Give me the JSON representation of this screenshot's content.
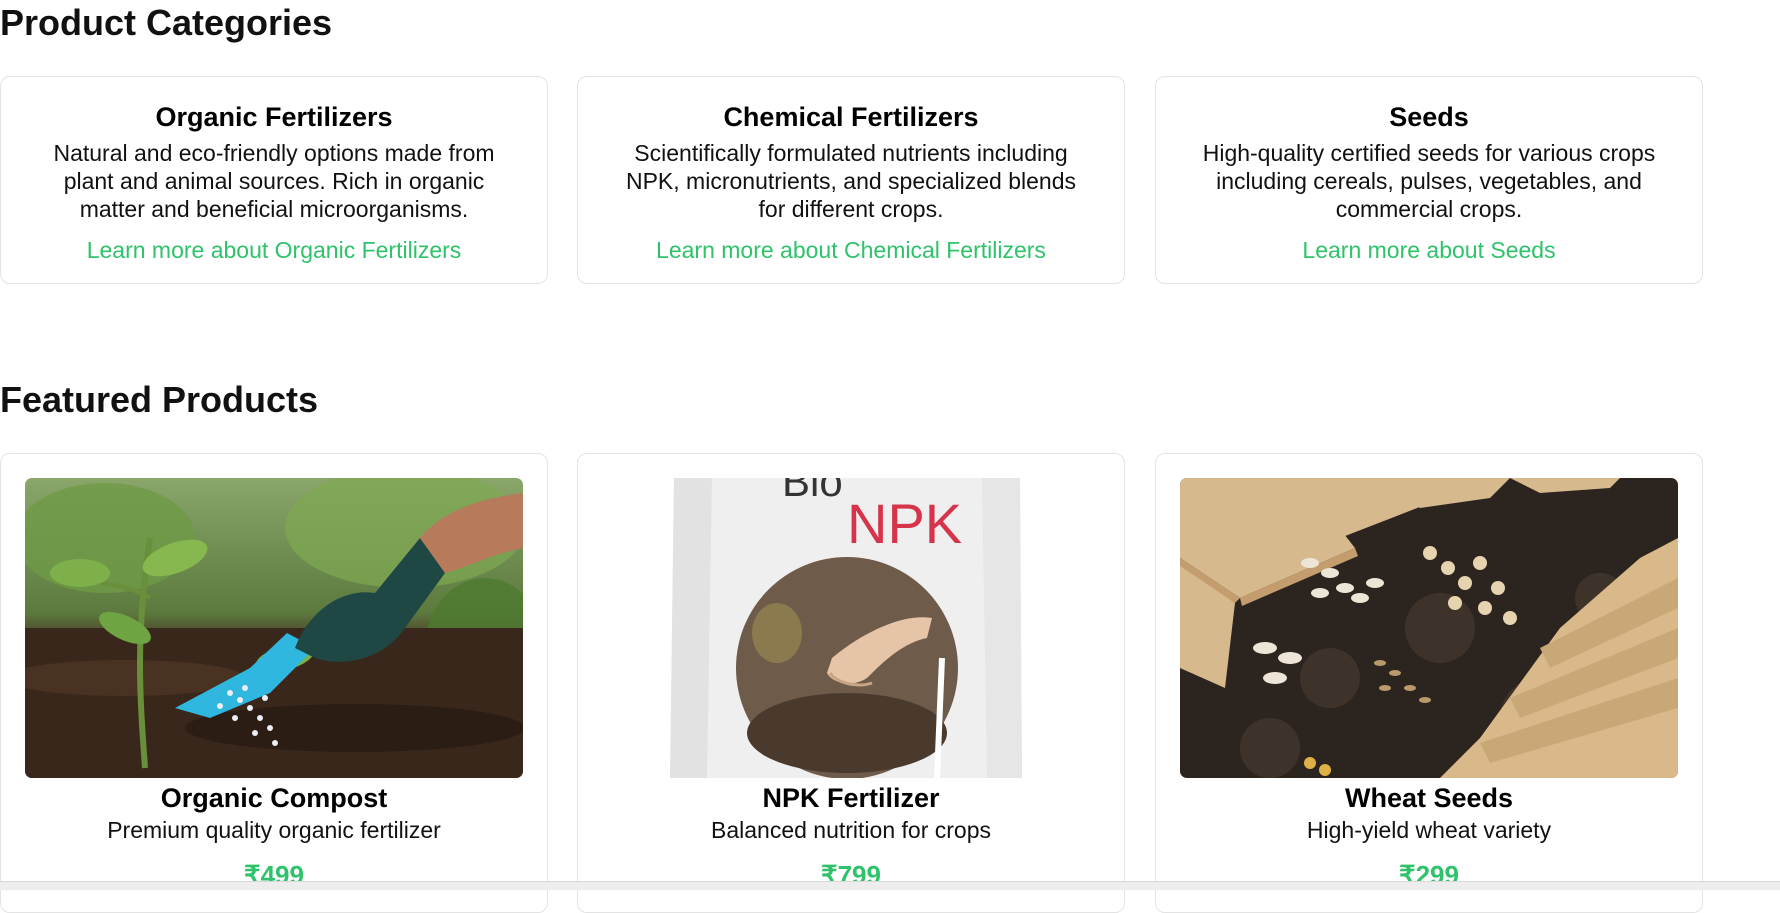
{
  "categories_section": {
    "title": "Product Categories",
    "items": [
      {
        "title": "Organic Fertilizers",
        "description": "Natural and eco-friendly options made from plant and animal sources. Rich in organic matter and beneficial microorganisms.",
        "link": "Learn more about Organic Fertilizers"
      },
      {
        "title": "Chemical Fertilizers",
        "description": "Scientifically formulated nutrients including NPK, micronutrients, and specialized blends for different crops.",
        "link": "Learn more about Chemical Fertilizers"
      },
      {
        "title": "Seeds",
        "description": "High-quality certified seeds for various crops including cereals, pulses, vegetables, and commercial crops.",
        "link": "Learn more about Seeds"
      }
    ]
  },
  "featured_section": {
    "title": "Featured Products",
    "products": [
      {
        "name": "Organic Compost",
        "description": "Premium quality organic fertilizer",
        "price": "₹499",
        "image_icon": "gardening-hand-trowel-image"
      },
      {
        "name": "NPK Fertilizer",
        "description": "Balanced nutrition for crops",
        "price": "₹799",
        "image_icon": "fertilizer-bag-image",
        "image_text_top": "Bio",
        "image_text_main": "NPK"
      },
      {
        "name": "Wheat Seeds",
        "description": "High-yield wheat variety",
        "price": "₹299",
        "image_icon": "seed-packets-soil-image"
      }
    ]
  },
  "colors": {
    "accent": "#2ec36a",
    "text": "#111111",
    "border": "#e3e3e3",
    "npk_red": "#d6344a"
  }
}
